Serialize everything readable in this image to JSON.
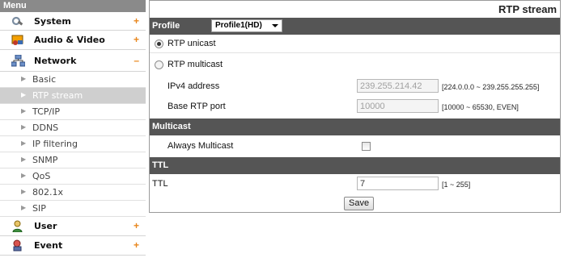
{
  "sidebar": {
    "header": "Menu",
    "system": {
      "label": "System",
      "toggle": "+"
    },
    "audio_video": {
      "label": "Audio & Video",
      "toggle": "+"
    },
    "network": {
      "label": "Network",
      "toggle": "–",
      "items": [
        "Basic",
        "RTP stream",
        "TCP/IP",
        "DDNS",
        "IP filtering",
        "SNMP",
        "QoS",
        "802.1x",
        "SIP"
      ],
      "active": "RTP stream"
    },
    "user": {
      "label": "User",
      "toggle": "+"
    },
    "event": {
      "label": "Event",
      "toggle": "+"
    }
  },
  "main": {
    "title": "RTP stream",
    "profile": {
      "label": "Profile",
      "selected": "Profile1(HD)"
    },
    "unicast": {
      "label": "RTP unicast",
      "selected": true
    },
    "multicast": {
      "label": "RTP multicast",
      "selected": false,
      "ipv4": {
        "label": "IPv4 address",
        "value": "239.255.214.42",
        "hint": "[224.0.0.0 ~ 239.255.255.255]"
      },
      "port": {
        "label": "Base RTP port",
        "value": "10000",
        "hint": "[10000 ~ 65530, EVEN]"
      }
    },
    "multicast_section": {
      "label": "Multicast",
      "always": {
        "label": "Always Multicast",
        "checked": false
      }
    },
    "ttl_section": {
      "label": "TTL",
      "ttl": {
        "label": "TTL",
        "value": "7",
        "hint": "[1 ~ 255]"
      }
    },
    "save_label": "Save"
  }
}
